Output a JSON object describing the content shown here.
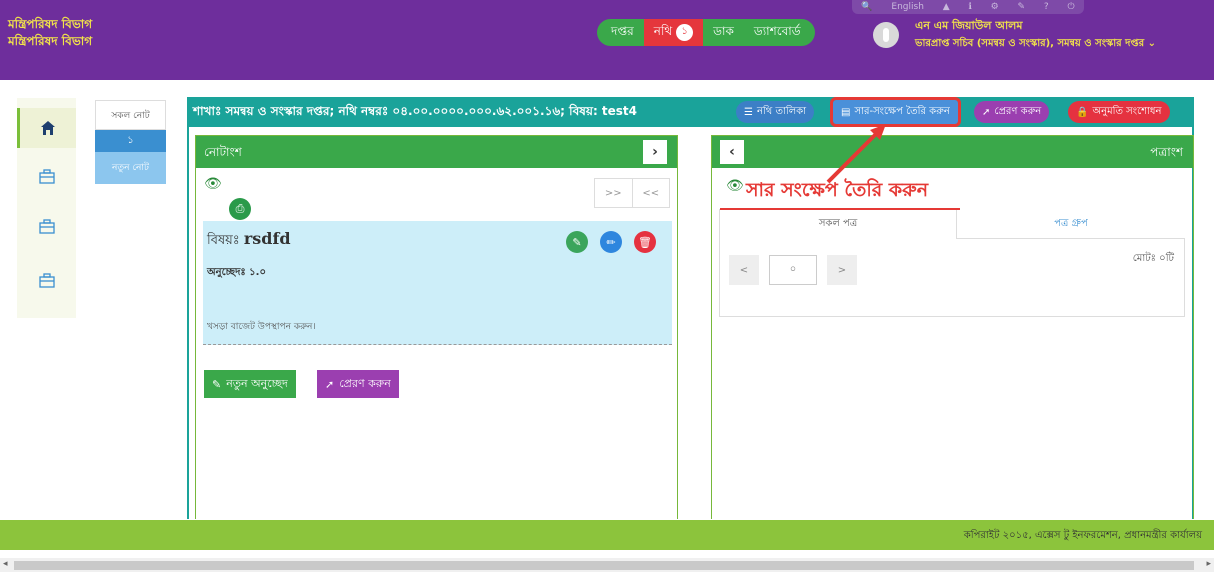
{
  "header": {
    "org_line1": "মন্ত্রিপরিষদ বিভাগ",
    "org_line2": "মন্ত্রিপরিষদ বিভাগ",
    "topbar_lang": "English",
    "nav": {
      "office": "দপ্তর",
      "note": "নথি",
      "note_badge": "১",
      "dak": "ডাক",
      "dashboard": "ড্যাশবোর্ড"
    },
    "user_name": "এন এম জিয়াউল আলম",
    "user_role": "ভারপ্রাপ্ত সচিব (সমন্বয় ও সংস্কার), সমন্বয় ও সংস্কার দপ্তর"
  },
  "sidebar": {
    "all_notes": "সকল নোট",
    "note_number": "১",
    "new_note": "নতুন নোট"
  },
  "main": {
    "breadcrumb": "শাখাঃ সমন্বয় ও সংস্কার দপ্তর; নথি নম্বরঃ ০৪.০০.০০০০.০০০.৬২.০০১.১৬; বিষয়: test4",
    "btn_list": "নথি তালিকা",
    "btn_summary": "সার-সংক্ষেপ তৈরি করুন",
    "btn_send": "প্রেরণ করুন",
    "btn_permission": "অনুমতি সংশোধন"
  },
  "note_panel": {
    "title": "নোটাংশ",
    "pager_next": ">>",
    "pager_prev": "<<",
    "subject_label": "বিষয়ঃ",
    "subject_value": "rsdfd",
    "paragraph": "অনুচ্ছেদঃ ১.০",
    "draft_text": "খসড়া বাজেট উপস্থাপন করুন।",
    "btn_new_paragraph": "নতুন অনুচ্ছেদ",
    "btn_send": "প্রেরণ করুন"
  },
  "letter_panel": {
    "title": "পত্রাংশ",
    "annotation": "সার সংক্ষেপ তৈরি করুন",
    "tab_all": "সকল পত্র",
    "tab_group": "পত্র গ্রুপ",
    "page_value": "০",
    "total": "মোটঃ ০টি"
  },
  "footer": {
    "copyright": "কপিরাইট ২০১৫, এক্সেস টু ইনফরমেশন, প্রধানমন্ত্রীর কার্যালয়"
  },
  "colors": {
    "header": "#6e2e9c",
    "teal": "#1aa39a",
    "green": "#3aa84a",
    "footer": "#8cc43c",
    "highlight": "#e53935"
  }
}
